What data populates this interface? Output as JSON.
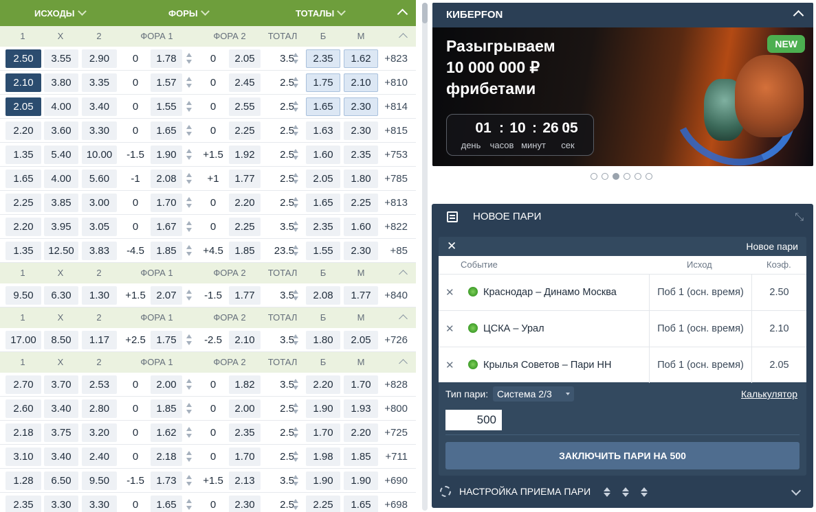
{
  "top_tabs": {
    "outcomes": "ИСХОДЫ",
    "handicaps": "ФОРЫ",
    "totals": "ТОТАЛЫ"
  },
  "column_headers": {
    "c1": "1",
    "cx": "X",
    "c2": "2",
    "h1": "ФОРА 1",
    "h2": "ФОРА 2",
    "total": "ТОТАЛ",
    "over": "Б",
    "under": "М"
  },
  "blocks": [
    {
      "rows": [
        {
          "o1": "2.50",
          "ox": "3.55",
          "o2": "2.90",
          "h1v": "0",
          "h1o": "1.78",
          "h2v": "0",
          "h2o": "2.05",
          "tv": "3.5",
          "over": "2.35",
          "under": "1.62",
          "more": "+823",
          "sel": "o1",
          "hl": [
            "over",
            "under"
          ]
        },
        {
          "o1": "2.10",
          "ox": "3.80",
          "o2": "3.35",
          "h1v": "0",
          "h1o": "1.57",
          "h2v": "0",
          "h2o": "2.45",
          "tv": "2.5",
          "over": "1.75",
          "under": "2.10",
          "more": "+810",
          "sel": "o1",
          "hl": [
            "over",
            "under"
          ]
        },
        {
          "o1": "2.05",
          "ox": "4.00",
          "o2": "3.40",
          "h1v": "0",
          "h1o": "1.55",
          "h2v": "0",
          "h2o": "2.55",
          "tv": "2.5",
          "over": "1.65",
          "under": "2.30",
          "more": "+814",
          "sel": "o1",
          "hl": [
            "over",
            "under"
          ]
        },
        {
          "o1": "2.20",
          "ox": "3.60",
          "o2": "3.30",
          "h1v": "0",
          "h1o": "1.65",
          "h2v": "0",
          "h2o": "2.25",
          "tv": "2.5",
          "over": "1.63",
          "under": "2.30",
          "more": "+815"
        },
        {
          "o1": "1.35",
          "ox": "5.40",
          "o2": "10.00",
          "h1v": "-1.5",
          "h1o": "1.90",
          "h2v": "+1.5",
          "h2o": "1.92",
          "tv": "2.5",
          "over": "1.60",
          "under": "2.35",
          "more": "+753"
        },
        {
          "o1": "1.65",
          "ox": "4.00",
          "o2": "5.60",
          "h1v": "-1",
          "h1o": "2.08",
          "h2v": "+1",
          "h2o": "1.77",
          "tv": "2.5",
          "over": "2.05",
          "under": "1.80",
          "more": "+785"
        },
        {
          "o1": "2.25",
          "ox": "3.85",
          "o2": "3.00",
          "h1v": "0",
          "h1o": "1.70",
          "h2v": "0",
          "h2o": "2.20",
          "tv": "2.5",
          "over": "1.65",
          "under": "2.25",
          "more": "+813"
        },
        {
          "o1": "2.20",
          "ox": "3.95",
          "o2": "3.05",
          "h1v": "0",
          "h1o": "1.67",
          "h2v": "0",
          "h2o": "2.25",
          "tv": "3.5",
          "over": "2.35",
          "under": "1.60",
          "more": "+822"
        },
        {
          "o1": "1.35",
          "ox": "12.50",
          "o2": "3.83",
          "h1v": "-4.5",
          "h1o": "1.85",
          "h2v": "+4.5",
          "h2o": "1.85",
          "tv": "23.5",
          "over": "1.55",
          "under": "2.30",
          "more": "+85"
        }
      ]
    },
    {
      "rows": [
        {
          "o1": "9.50",
          "ox": "6.30",
          "o2": "1.30",
          "h1v": "+1.5",
          "h1o": "2.07",
          "h2v": "-1.5",
          "h2o": "1.77",
          "tv": "3.5",
          "over": "2.08",
          "under": "1.77",
          "more": "+840"
        }
      ]
    },
    {
      "rows": [
        {
          "o1": "17.00",
          "ox": "8.50",
          "o2": "1.17",
          "h1v": "+2.5",
          "h1o": "1.75",
          "h2v": "-2.5",
          "h2o": "2.10",
          "tv": "3.5",
          "over": "1.80",
          "under": "2.05",
          "more": "+726"
        }
      ]
    },
    {
      "rows": [
        {
          "o1": "2.70",
          "ox": "3.70",
          "o2": "2.53",
          "h1v": "0",
          "h1o": "2.00",
          "h2v": "0",
          "h2o": "1.82",
          "tv": "3.5",
          "over": "2.20",
          "under": "1.70",
          "more": "+828"
        },
        {
          "o1": "2.60",
          "ox": "3.40",
          "o2": "2.80",
          "h1v": "0",
          "h1o": "1.85",
          "h2v": "0",
          "h2o": "2.00",
          "tv": "2.5",
          "over": "1.90",
          "under": "1.93",
          "more": "+800"
        },
        {
          "o1": "2.18",
          "ox": "3.75",
          "o2": "3.20",
          "h1v": "0",
          "h1o": "1.62",
          "h2v": "0",
          "h2o": "2.35",
          "tv": "2.5",
          "over": "1.70",
          "under": "2.20",
          "more": "+725"
        },
        {
          "o1": "3.10",
          "ox": "3.40",
          "o2": "2.40",
          "h1v": "0",
          "h1o": "2.18",
          "h2v": "0",
          "h2o": "1.70",
          "tv": "2.5",
          "over": "1.98",
          "under": "1.85",
          "more": "+711"
        },
        {
          "o1": "1.28",
          "ox": "6.50",
          "o2": "9.50",
          "h1v": "-1.5",
          "h1o": "1.73",
          "h2v": "+1.5",
          "h2o": "2.13",
          "tv": "3.5",
          "over": "1.90",
          "under": "1.90",
          "more": "+690"
        },
        {
          "o1": "2.35",
          "ox": "3.30",
          "o2": "3.30",
          "h1v": "0",
          "h1o": "1.65",
          "h2v": "0",
          "h2o": "2.30",
          "tv": "2.5",
          "over": "2.25",
          "under": "1.65",
          "more": "+698"
        }
      ]
    }
  ],
  "banner": {
    "title": "КИБЕРFON",
    "headline_1": "Разыгрываем",
    "headline_2": "10 000 000 ₽",
    "headline_3": "фрибетами",
    "badge": "NEW",
    "timer": {
      "days": "01",
      "hours": "10",
      "minutes": "26",
      "seconds": "05",
      "days_label": "день",
      "hours_label": "часов",
      "minutes_label": "минут",
      "seconds_label": "сек",
      "sep": ":"
    },
    "active_dot": 3,
    "dots_total": 6
  },
  "bet_slip": {
    "title": "НОВОЕ ПАРИ",
    "inner_title": "Новое пари",
    "close": "✕",
    "col_event": "Событие",
    "col_outcome": "Исход",
    "col_coef": "Коэф.",
    "remove": "✕",
    "items": [
      {
        "event": "Краснодар – Динамо Москва",
        "outcome": "Поб 1 (осн. время)",
        "coef": "2.50"
      },
      {
        "event": "ЦСКА – Урал",
        "outcome": "Поб 1 (осн. время)",
        "coef": "2.10"
      },
      {
        "event": "Крылья Советов – Пари НН",
        "outcome": "Поб 1 (осн. время)",
        "coef": "2.05"
      }
    ],
    "bet_type_label": "Тип пари:",
    "bet_type_value": "Система 2/3",
    "calculator": "Калькулятор",
    "amount": "500",
    "place_button": "ЗАКЛЮЧИТЬ ПАРИ НА 500",
    "settings": "НАСТРОЙКА ПРИЕМА ПАРИ"
  },
  "colors": {
    "green_header": "#6e9e3c",
    "selected_odd": "#2b4c6f",
    "panel_bg": "#2b3f55",
    "new_badge": "#4caf50"
  }
}
